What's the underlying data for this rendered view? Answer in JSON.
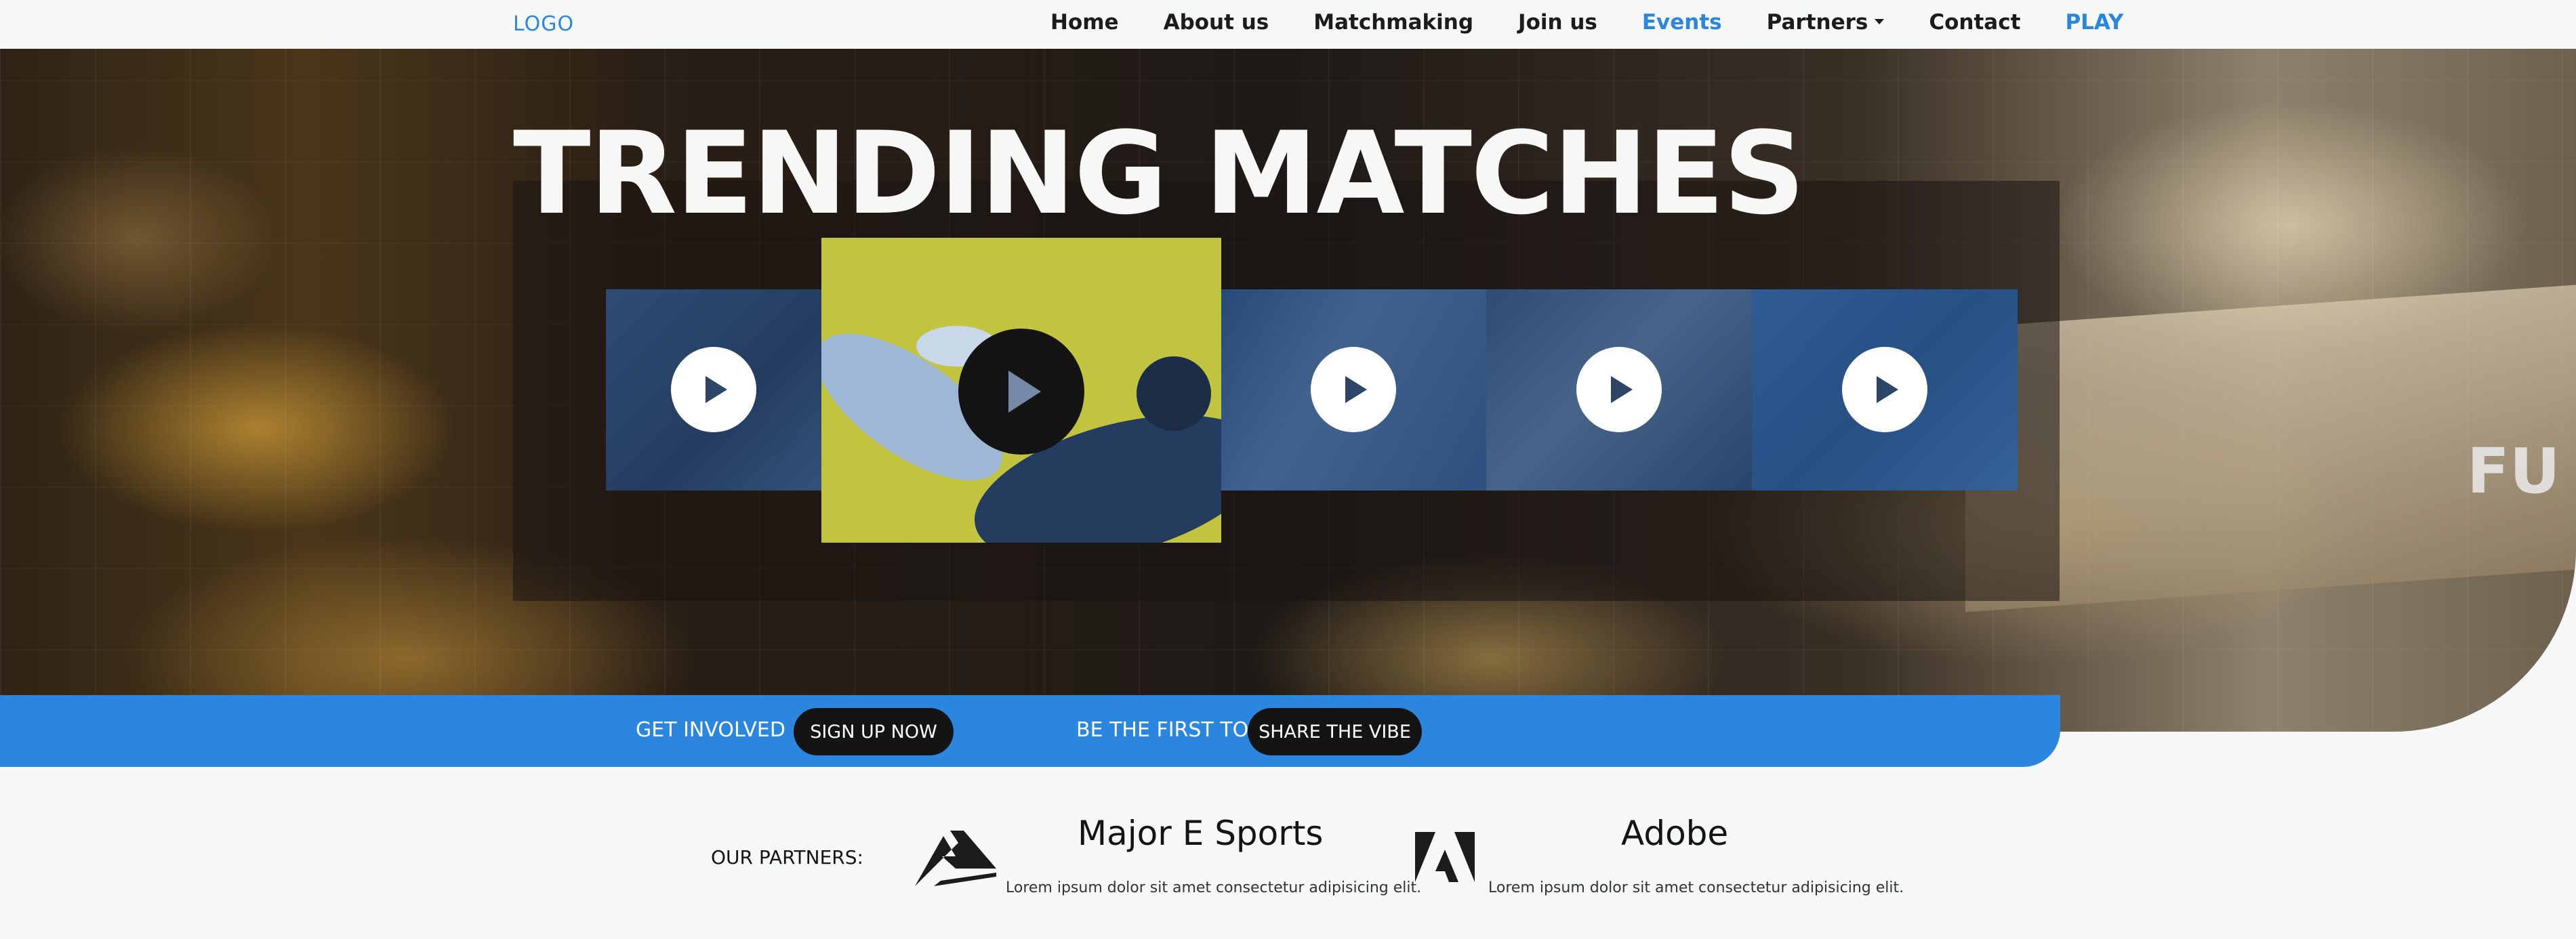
{
  "nav": {
    "logo": "LOGO",
    "items": [
      {
        "label": "Home"
      },
      {
        "label": "About us"
      },
      {
        "label": "Matchmaking"
      },
      {
        "label": "Join us"
      },
      {
        "label": "Events"
      },
      {
        "label": "Partners"
      },
      {
        "label": "Contact"
      },
      {
        "label": "PLAY"
      }
    ],
    "active_item": "Events",
    "accent_color": "#2a86de"
  },
  "hero": {
    "title": "TRENDING MATCHES",
    "videos": [
      {
        "icon": "play-icon"
      },
      {
        "icon": "play-icon"
      },
      {
        "icon": "play-icon"
      },
      {
        "icon": "play-icon"
      },
      {
        "icon": "play-icon"
      }
    ]
  },
  "cta": {
    "left_label": "GET INVOLVED",
    "left_button": "SIGN UP NOW",
    "right_label": "BE THE FIRST TO",
    "right_button": "SHARE THE VIBE",
    "bar_color": "#2a86de"
  },
  "partners": {
    "label": "OUR PARTNERS:",
    "items": [
      {
        "name": "Major E Sports",
        "desc": "Lorem ipsum dolor sit amet consectetur adipisicing elit."
      },
      {
        "name": "Adobe",
        "desc": "Lorem ipsum dolor sit amet consectetur adipisicing elit."
      }
    ]
  }
}
